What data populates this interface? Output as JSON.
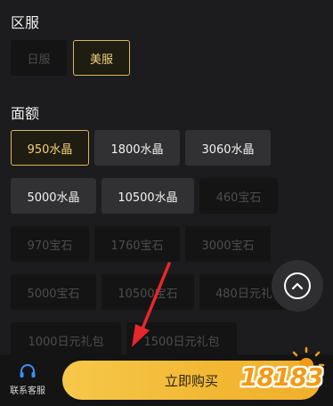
{
  "server": {
    "title": "区服",
    "options": [
      {
        "label": "日服",
        "state": "normal"
      },
      {
        "label": "美服",
        "state": "selected"
      }
    ]
  },
  "amount": {
    "title": "面额",
    "options": [
      {
        "label": "950水晶",
        "state": "selected"
      },
      {
        "label": "1800水晶",
        "state": "normal"
      },
      {
        "label": "3060水晶",
        "state": "normal"
      },
      {
        "label": "5000水晶",
        "state": "normal"
      },
      {
        "label": "10500水晶",
        "state": "normal"
      },
      {
        "label": "460宝石",
        "state": "disabled"
      },
      {
        "label": "970宝石",
        "state": "disabled"
      },
      {
        "label": "1760宝石",
        "state": "disabled"
      },
      {
        "label": "3000宝石",
        "state": "disabled"
      },
      {
        "label": "5000宝石",
        "state": "disabled"
      },
      {
        "label": "10500宝石",
        "state": "disabled"
      },
      {
        "label": "480日元礼包",
        "state": "disabled"
      },
      {
        "label": "1000日元礼包",
        "state": "disabled"
      },
      {
        "label": "1500日元礼包",
        "state": "disabled"
      }
    ]
  },
  "bottom_bar": {
    "service_label": "联系客服",
    "service_icon": "headset-icon",
    "buy_label": "立即购买"
  },
  "watermark": {
    "text": "18183"
  },
  "colors": {
    "accent": "#d6b85b",
    "buy_button": "#f2b733",
    "annotation_arrow": "#e8272b"
  }
}
